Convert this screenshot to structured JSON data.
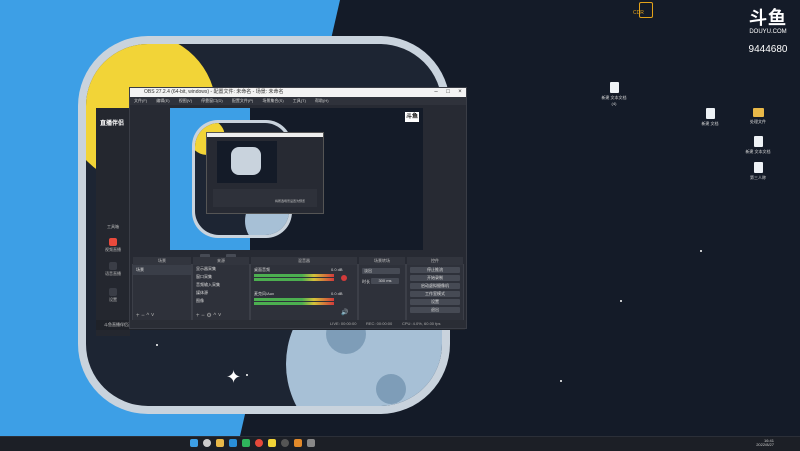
{
  "desktop": {
    "watermark": {
      "brand": "斗鱼",
      "site": "DOUYU.COM",
      "room_id": "9444680"
    },
    "top_app_label": "CDR",
    "icons": [
      {
        "name": "desktop-icon-file-1",
        "label": "新建 文本文档 (4)",
        "type": "file"
      },
      {
        "name": "desktop-icon-file-2",
        "label": "新建 文档",
        "type": "file"
      },
      {
        "name": "desktop-icon-folder-1",
        "label": "处理文件",
        "type": "folder"
      },
      {
        "name": "desktop-icon-file-3",
        "label": "新建 文本文档",
        "type": "file"
      },
      {
        "name": "desktop-icon-file-4",
        "label": "第三人称",
        "type": "file"
      }
    ]
  },
  "obs": {
    "title": "OBS 27.2.4 (64-bit, windows) - 配置文件: 未命名 - 场景: 未命名",
    "menu": [
      "文件(F)",
      "编辑(E)",
      "视图(V)",
      "停靠窗口(D)",
      "配置文件(P)",
      "场景集合(S)",
      "工具(T)",
      "帮助(H)"
    ],
    "preview_caption": "将所选场景设置为预览",
    "docks": {
      "scenes": {
        "title": "场景",
        "items": [
          "场景"
        ]
      },
      "sources": {
        "title": "来源",
        "items": [
          "显示器采集",
          "窗口采集",
          "音频输入采集",
          "媒体源",
          "图像"
        ]
      },
      "mixer": {
        "title": "混音器",
        "channels": [
          {
            "label": "桌面音频",
            "level": "0.0 dB"
          },
          {
            "label": "麦克风/Aux",
            "level": "0.0 dB"
          }
        ]
      },
      "transitions": {
        "title": "场景转场",
        "type": "淡出",
        "duration_label": "时长",
        "duration": "300 ms"
      },
      "controls": {
        "title": "控件",
        "buttons": [
          "停止推流",
          "开始录制",
          "启动虚拟摄像机",
          "工作室模式",
          "设置",
          "退出"
        ]
      }
    },
    "status": {
      "live": "LIVE: 00:00:00",
      "rec": "REC: 00:00:00",
      "cpu": "CPU: 4.0%, 60.00 fps",
      "dropped": "0 (0.0%)",
      "kbps": "kb/s: 0"
    }
  },
  "tool": {
    "brand": "直播伴侣",
    "nav": [
      {
        "label": "工具箱"
      },
      {
        "label": "视频直播"
      },
      {
        "label": "语音直播"
      },
      {
        "label": "设置"
      }
    ],
    "bottom_notice": "斗鱼直播伴侣正在运行"
  },
  "taskbar": {
    "time": "16:41",
    "date": "2022/8/27",
    "apps": [
      "windows-logo",
      "search",
      "file-explorer",
      "edge",
      "wechat",
      "chrome",
      "qq",
      "obs",
      "douyu",
      "settings"
    ]
  },
  "colors": {
    "wallpaper_blue": "#3d9fe6",
    "wallpaper_dark": "#141b28",
    "sun": "#f2d437",
    "moon": "#a7c0d6",
    "obs_bg": "#272a33",
    "accent_red": "#e94a3c"
  }
}
